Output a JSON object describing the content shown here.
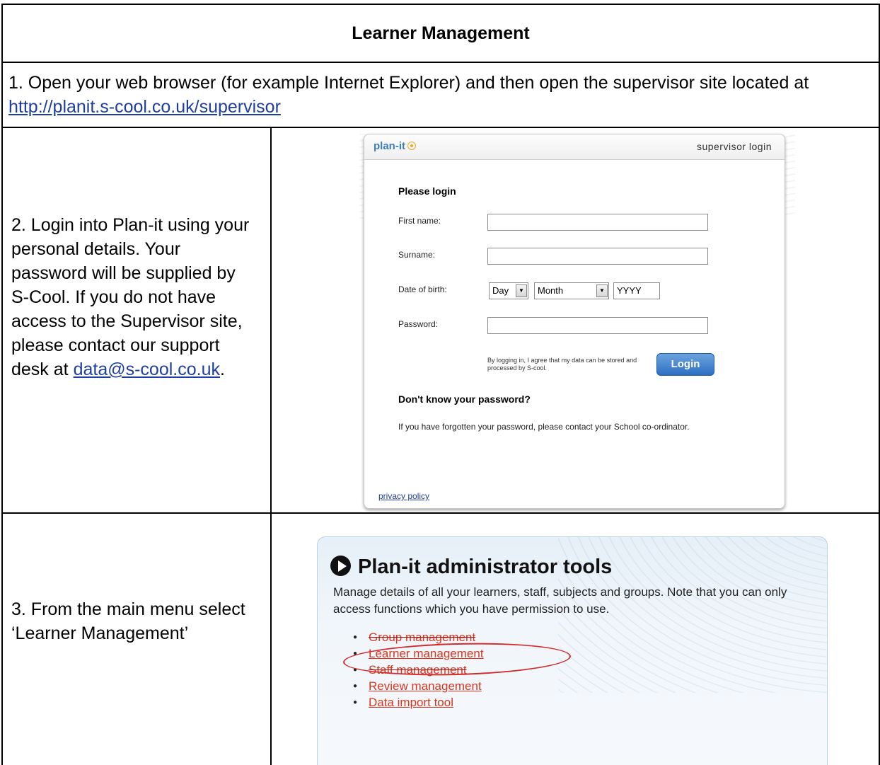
{
  "title": "Learner Management",
  "step1": {
    "text": "1. Open your web browser (for example Internet Explorer) and then open the supervisor site located at ",
    "link": "http://planit.s-cool.co.uk/supervisor"
  },
  "step2": {
    "text": "2.   Login into Plan-it using your personal details. Your password will be supplied by S-Cool. If you do not have access to the Supervisor site, please contact our support desk at ",
    "link": "data@s-cool.co.uk",
    "end": "."
  },
  "step3": {
    "text": "3. From the main menu select ‘Learner Management’"
  },
  "login": {
    "brand": "plan-it",
    "header_right": "supervisor login",
    "heading": "Please login",
    "first_name_label": "First name:",
    "surname_label": "Surname:",
    "dob_label": "Date of birth:",
    "day": "Day",
    "month": "Month",
    "year_placeholder": "YYYY",
    "password_label": "Password:",
    "agree_text": "By logging in, I agree that my data can be stored and processed by S-cool.",
    "login_button": "Login",
    "forgot_heading": "Don't know your password?",
    "forgot_text": "If you have forgotten your password, please contact your School co-ordinator.",
    "privacy": "privacy policy"
  },
  "admin": {
    "title": "Plan-it administrator tools",
    "description": "Manage details of all your learners, staff, subjects and groups. Note that you can only access functions which you have permission to use.",
    "items": [
      "Group management",
      "Learner management",
      "Staff management",
      "Review management",
      "Data import tool"
    ],
    "highlight_color": "#d12b2b",
    "link_color": "#d8361e"
  }
}
